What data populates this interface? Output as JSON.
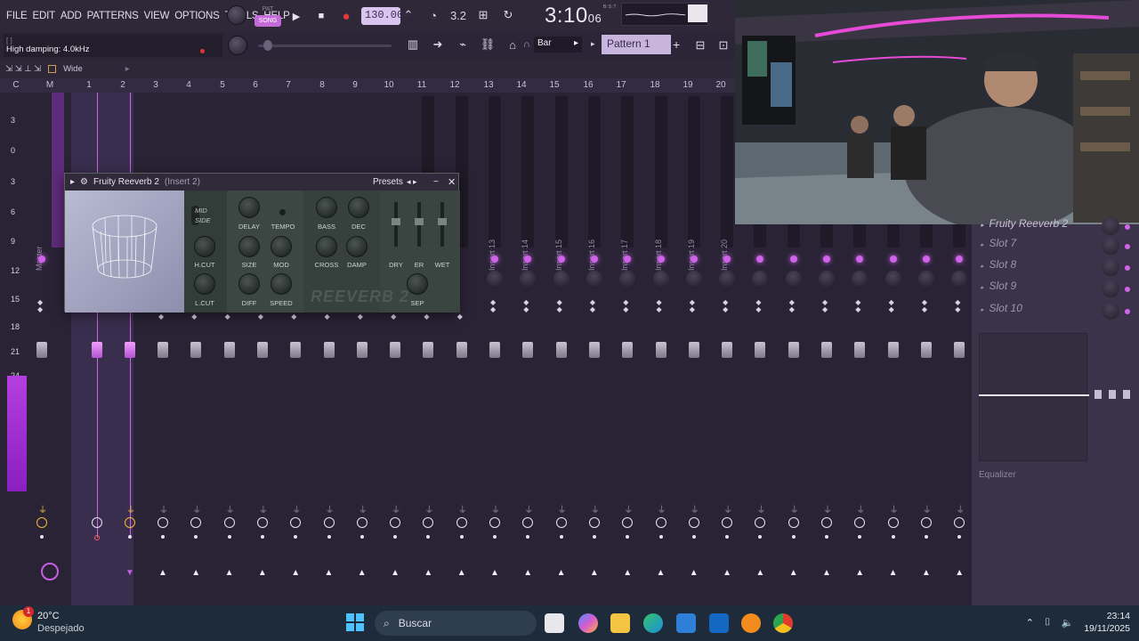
{
  "menu": [
    "FILE",
    "EDIT",
    "ADD",
    "PATTERNS",
    "VIEW",
    "OPTIONS",
    "TOOLS",
    "HELP"
  ],
  "transport": {
    "pat_label": "PAT",
    "song_label": "SONG",
    "tempo": "130.000",
    "play_icon": "▶",
    "stop_icon": "■",
    "record_icon": "●"
  },
  "clock": {
    "main": "3:10",
    "sub": "06",
    "unit": "B:S:T"
  },
  "hint": {
    "bracket": "[ ]",
    "text": "High damping: 4.0kHz"
  },
  "snap": {
    "value": "Bar"
  },
  "pattern": {
    "name": "Pattern 1",
    "add": "+"
  },
  "mixer_header": {
    "view": "Wide"
  },
  "column_numbers": [
    "C",
    "M",
    "1",
    "2",
    "3",
    "4",
    "5",
    "6",
    "7",
    "8",
    "9",
    "10",
    "11",
    "12",
    "13",
    "14",
    "15",
    "16",
    "17",
    "18",
    "19",
    "20"
  ],
  "db_scale": [
    "3",
    "0",
    "3",
    "6",
    "9",
    "12",
    "15",
    "18",
    "21",
    "24"
  ],
  "strip_labels": {
    "master": "Master",
    "insert13": "Insert 13",
    "insert14": "Insert 14",
    "insert15": "Insert 15",
    "insert16": "Insert 16",
    "insert17": "Insert 17",
    "insert18": "Insert 18",
    "insert19": "Insert 19",
    "insert20": "Insert 20"
  },
  "plugin": {
    "title": "Fruity Reeverb 2",
    "subtitle": "(Insert 2)",
    "presets": "Presets",
    "prev": "◂",
    "next": "▸",
    "minimize": "−",
    "close": "✕",
    "mid": "MID",
    "side": "SIDE",
    "labels": {
      "delay": "DELAY",
      "tempo": "TEMPO",
      "bass": "BASS",
      "dec": "DEC",
      "hcut": "H.CUT",
      "size": "SIZE",
      "mod": "MOD",
      "cross": "CROSS",
      "damp": "DAMP",
      "lcut": "L.CUT",
      "diff": "DIFF",
      "speed": "SPEED",
      "dry": "DRY",
      "er": "ER",
      "wet": "WET",
      "sep": "SEP"
    },
    "brand": "REEVERB 2"
  },
  "right_panel": {
    "slot_top": "Fruity Reeverb 2",
    "slots": [
      "Slot 7",
      "Slot 8",
      "Slot 9",
      "Slot 10"
    ],
    "eq_label": "Equalizer"
  },
  "taskbar": {
    "temp": "20°C",
    "weather": "Despejado",
    "badge": "1",
    "search": "Buscar",
    "time": "23:14",
    "date": "19/11/2025"
  },
  "colors": {
    "accent": "#cf63ea",
    "tempo_bg": "#d9c3ef",
    "record": "#e23a3a"
  }
}
